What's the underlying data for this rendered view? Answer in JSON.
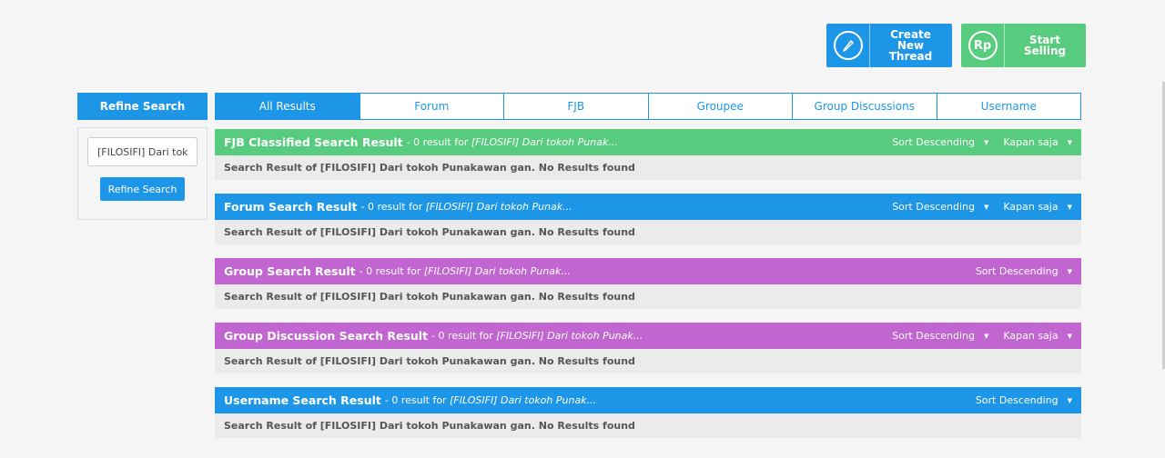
{
  "actions": {
    "create_thread": "Create New Thread",
    "start_selling": "Start Selling",
    "rp_icon": "Rp"
  },
  "sidebar": {
    "title": "Refine Search",
    "search_value": "[FILOSIFI] Dari tokoh Punakawan gan.",
    "button": "Refine Search"
  },
  "tabs": [
    "All Results",
    "Forum",
    "FJB",
    "Groupee",
    "Group Discussions",
    "Username"
  ],
  "results": [
    {
      "title": "FJB Classified Search Result",
      "count": "- 0 result for",
      "query": "[FILOSIFI] Dari tokoh Punak...",
      "sort": "Sort Descending",
      "time": "Kapan saja",
      "body": "Search Result of [FILOSIFI] Dari tokoh Punakawan gan. No Results found",
      "color": "#58cc7e"
    },
    {
      "title": "Forum Search Result",
      "count": "- 0 result for",
      "query": "[FILOSIFI] Dari tokoh Punak...",
      "sort": "Sort Descending",
      "time": "Kapan saja",
      "body": "Search Result of [FILOSIFI] Dari tokoh Punakawan gan. No Results found",
      "color": "#1e96e8"
    },
    {
      "title": "Group Search Result",
      "count": "- 0 result for",
      "query": "[FILOSIFI] Dari tokoh Punak...",
      "sort": "Sort Descending",
      "body": "Search Result of [FILOSIFI] Dari tokoh Punakawan gan. No Results found",
      "color": "#c165d0"
    },
    {
      "title": "Group Discussion Search Result",
      "count": "- 0 result for",
      "query": "[FILOSIFI] Dari tokoh Punak...",
      "sort": "Sort Descending",
      "time": "Kapan saja",
      "body": "Search Result of [FILOSIFI] Dari tokoh Punakawan gan. No Results found",
      "color": "#c165d0"
    },
    {
      "title": "Username Search Result",
      "count": "- 0 result for",
      "query": "[FILOSIFI] Dari tokoh Punak...",
      "sort": "Sort Descending",
      "body": "Search Result of [FILOSIFI] Dari tokoh Punakawan gan. No Results found",
      "color": "#1e96e8"
    }
  ],
  "icons": {
    "pencil": "pencil-icon",
    "rupiah": "rupiah-icon",
    "caret": "caret-down-icon"
  }
}
